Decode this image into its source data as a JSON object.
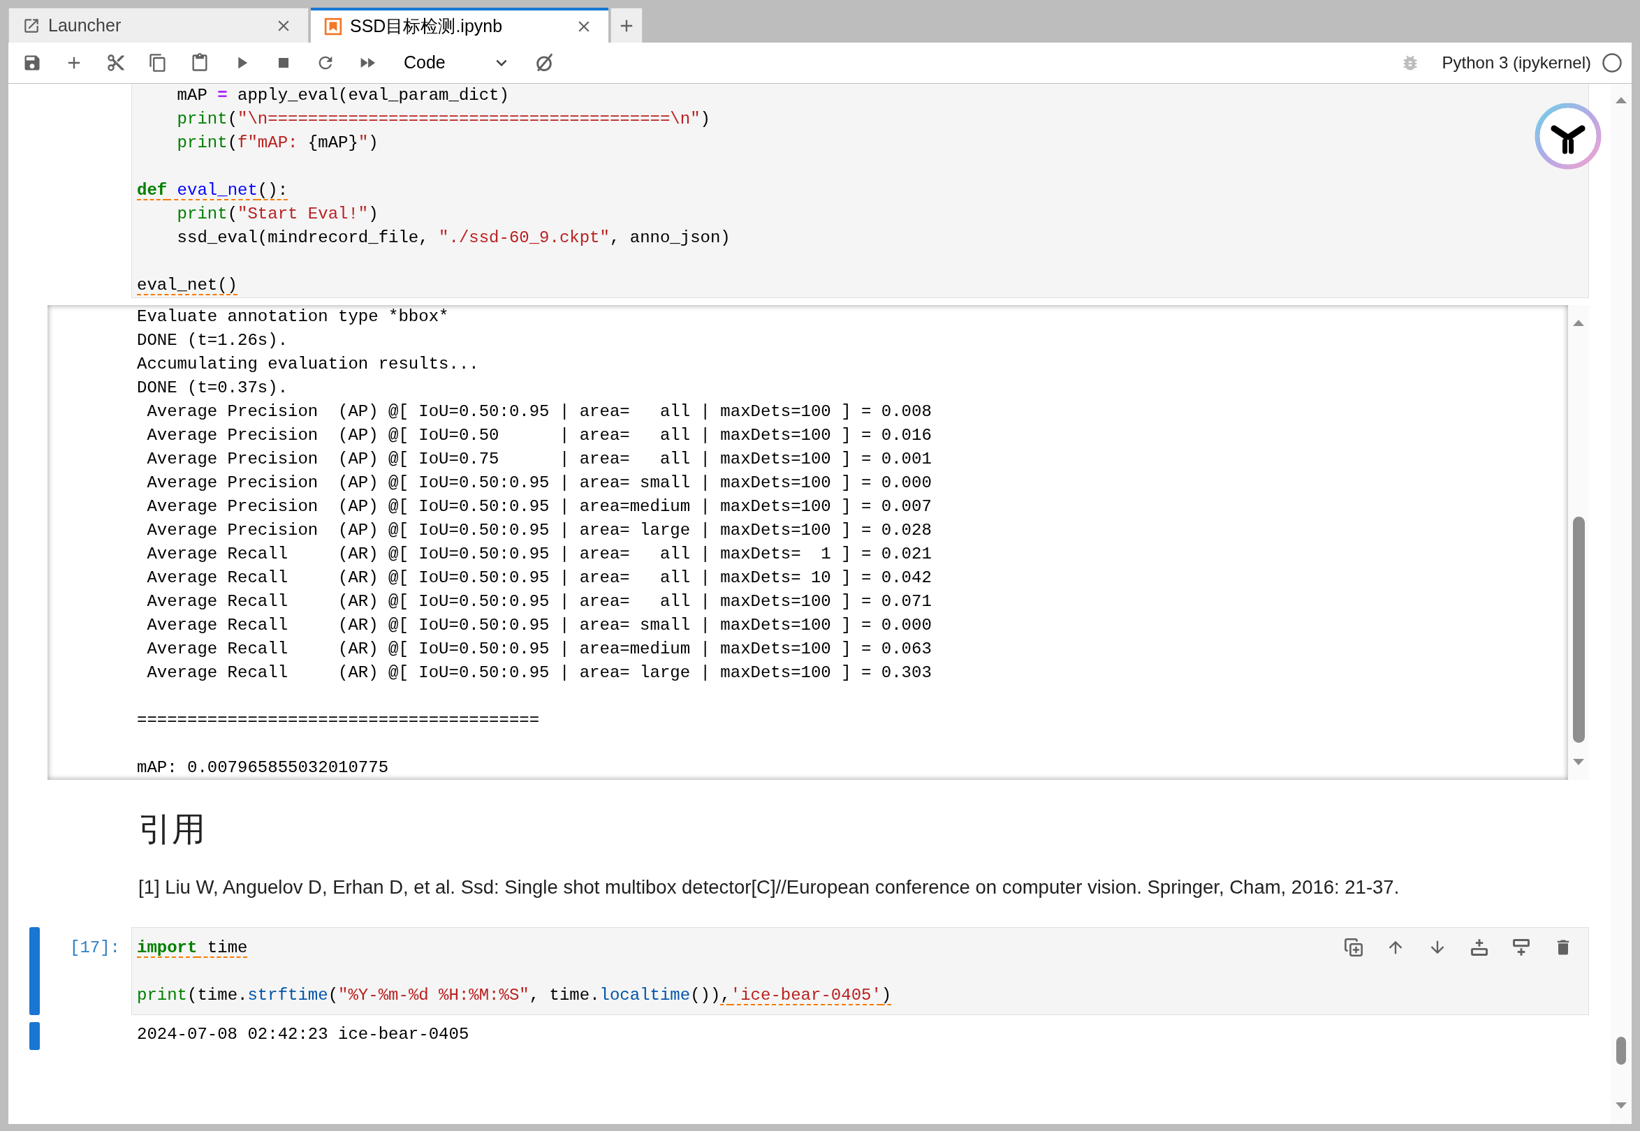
{
  "tabs": [
    {
      "kind": "launcher",
      "label": "Launcher",
      "selected": false
    },
    {
      "kind": "notebook",
      "label": "SSD目标检测.ipynb",
      "selected": true
    }
  ],
  "toolbar": {
    "cell_type": "Code",
    "debugger_on": false,
    "kernel": {
      "name": "Python 3 (ipykernel)",
      "busy": false
    }
  },
  "cells": [
    {
      "kind": "code",
      "selected": false,
      "code": [
        [
          [
            {
              "text": "    mAP ",
              "kind": "plain",
              "flagged": false
            },
            {
              "text": "=",
              "kind": "operator",
              "flagged": false
            },
            {
              "text": " apply_eval(eval_param_dict)",
              "kind": "plain",
              "flagged": false
            }
          ],
          [
            {
              "text": "    print",
              "kind": "builtin",
              "flagged": false
            },
            {
              "text": "(",
              "kind": "plain",
              "flagged": false
            },
            {
              "text": "\"\\n========================================\\n\"",
              "kind": "string",
              "flagged": false
            },
            {
              "text": ")",
              "kind": "plain",
              "flagged": false
            }
          ],
          [
            {
              "text": "    print",
              "kind": "builtin",
              "flagged": false
            },
            {
              "text": "(",
              "kind": "plain",
              "flagged": false
            },
            {
              "text": "f\"mAP: ",
              "kind": "string",
              "flagged": false
            },
            {
              "text": "{mAP}",
              "kind": "plain",
              "flagged": false
            },
            {
              "text": "\"",
              "kind": "string",
              "flagged": false
            },
            {
              "text": ")",
              "kind": "plain",
              "flagged": false
            }
          ]
        ],
        [
          [
            {
              "text": "def",
              "kind": "keyword",
              "flagged": true
            },
            {
              "text": " eval_net",
              "kind": "def",
              "flagged": true
            },
            {
              "text": "():",
              "kind": "plain",
              "flagged": true
            }
          ],
          [
            {
              "text": "    print",
              "kind": "builtin",
              "flagged": false
            },
            {
              "text": "(",
              "kind": "plain",
              "flagged": false
            },
            {
              "text": "\"Start Eval!\"",
              "kind": "string",
              "flagged": false
            },
            {
              "text": ")",
              "kind": "plain",
              "flagged": false
            }
          ],
          [
            {
              "text": "    ssd_eval(mindrecord_file, ",
              "kind": "plain",
              "flagged": false
            },
            {
              "text": "\"./ssd-60_9.ckpt\"",
              "kind": "string",
              "flagged": false
            },
            {
              "text": ", anno_json)",
              "kind": "plain",
              "flagged": false
            }
          ]
        ],
        [
          [
            {
              "text": "eval_net()",
              "kind": "plain",
              "flagged": true
            }
          ]
        ]
      ],
      "output": {
        "scrolled": true,
        "blocks": [
          [
            "Evaluate annotation type *bbox*",
            "DONE (t=1.26s).",
            "Accumulating evaluation results...",
            "DONE (t=0.37s).",
            " Average Precision  (AP) @[ IoU=0.50:0.95 | area=   all | maxDets=100 ] = 0.008",
            " Average Precision  (AP) @[ IoU=0.50      | area=   all | maxDets=100 ] = 0.016",
            " Average Precision  (AP) @[ IoU=0.75      | area=   all | maxDets=100 ] = 0.001",
            " Average Precision  (AP) @[ IoU=0.50:0.95 | area= small | maxDets=100 ] = 0.000",
            " Average Precision  (AP) @[ IoU=0.50:0.95 | area=medium | maxDets=100 ] = 0.007",
            " Average Precision  (AP) @[ IoU=0.50:0.95 | area= large | maxDets=100 ] = 0.028",
            " Average Recall     (AR) @[ IoU=0.50:0.95 | area=   all | maxDets=  1 ] = 0.021",
            " Average Recall     (AR) @[ IoU=0.50:0.95 | area=   all | maxDets= 10 ] = 0.042",
            " Average Recall     (AR) @[ IoU=0.50:0.95 | area=   all | maxDets=100 ] = 0.071",
            " Average Recall     (AR) @[ IoU=0.50:0.95 | area= small | maxDets=100 ] = 0.000",
            " Average Recall     (AR) @[ IoU=0.50:0.95 | area=medium | maxDets=100 ] = 0.063",
            " Average Recall     (AR) @[ IoU=0.50:0.95 | area= large | maxDets=100 ] = 0.303"
          ],
          [
            "========================================"
          ],
          [
            "mAP: 0.007965855032010775"
          ]
        ]
      }
    },
    {
      "kind": "markdown",
      "selected": false,
      "heading": "引用",
      "paragraph": "[1] Liu W, Anguelov D, Erhan D, et al. Ssd: Single shot multibox detector[C]//European conference on computer vision. Springer, Cham, 2016: 21-37."
    },
    {
      "kind": "code",
      "selected": true,
      "prompt": "[17]:",
      "code": [
        [
          [
            {
              "text": "import",
              "kind": "keyword",
              "flagged": true
            },
            {
              "text": " time",
              "kind": "plain",
              "flagged": true
            }
          ]
        ],
        [
          [
            {
              "text": "print",
              "kind": "builtin",
              "flagged": false
            },
            {
              "text": "(time.",
              "kind": "plain",
              "flagged": false
            },
            {
              "text": "strftime",
              "kind": "property",
              "flagged": false
            },
            {
              "text": "(",
              "kind": "plain",
              "flagged": false
            },
            {
              "text": "\"%Y-%m-%d %H:%M:%S\"",
              "kind": "string",
              "flagged": false
            },
            {
              "text": ", time.",
              "kind": "plain",
              "flagged": false
            },
            {
              "text": "localtime",
              "kind": "property",
              "flagged": false
            },
            {
              "text": "())",
              "kind": "plain",
              "flagged": false
            },
            {
              "text": ",",
              "kind": "plain",
              "flagged": true
            },
            {
              "text": "'ice-bear-0405'",
              "kind": "string",
              "flagged": true
            },
            {
              "text": ")",
              "kind": "plain",
              "flagged": true
            }
          ]
        ]
      ],
      "output": {
        "scrolled": false,
        "blocks": [
          [
            "2024-07-08 02:42:23 ice-bear-0405"
          ]
        ]
      }
    }
  ]
}
